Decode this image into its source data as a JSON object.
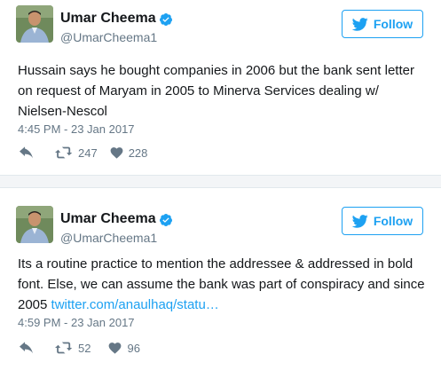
{
  "tweets": [
    {
      "author": {
        "name": "Umar Cheema",
        "handle": "@UmarCheema1"
      },
      "follow_label": "Follow",
      "text": "Hussain says he bought companies in 2006 but the bank sent letter on request of Maryam in 2005 to Minerva Services dealing w/ Nielsen-Nescol",
      "timestamp": "4:45 PM - 23 Jan 2017",
      "retweets": "247",
      "likes": "228"
    },
    {
      "author": {
        "name": "Umar Cheema",
        "handle": "@UmarCheema1"
      },
      "follow_label": "Follow",
      "text": "Its a routine practice to mention the addressee & addressed in bold font. Else, we can assume the bank was part of conspiracy and since 2005 ",
      "link_text": "twitter.com/anaulhaq/statu…",
      "timestamp": "4:59 PM - 23 Jan 2017",
      "retweets": "52",
      "likes": "96"
    }
  ],
  "icons": {
    "verified": "verified-badge-icon",
    "follow": "twitter-bird-icon",
    "reply": "reply-icon",
    "retweet": "retweet-icon",
    "like": "heart-icon"
  },
  "colors": {
    "accent": "#1da1f2",
    "muted": "#657786",
    "text": "#14171a"
  }
}
